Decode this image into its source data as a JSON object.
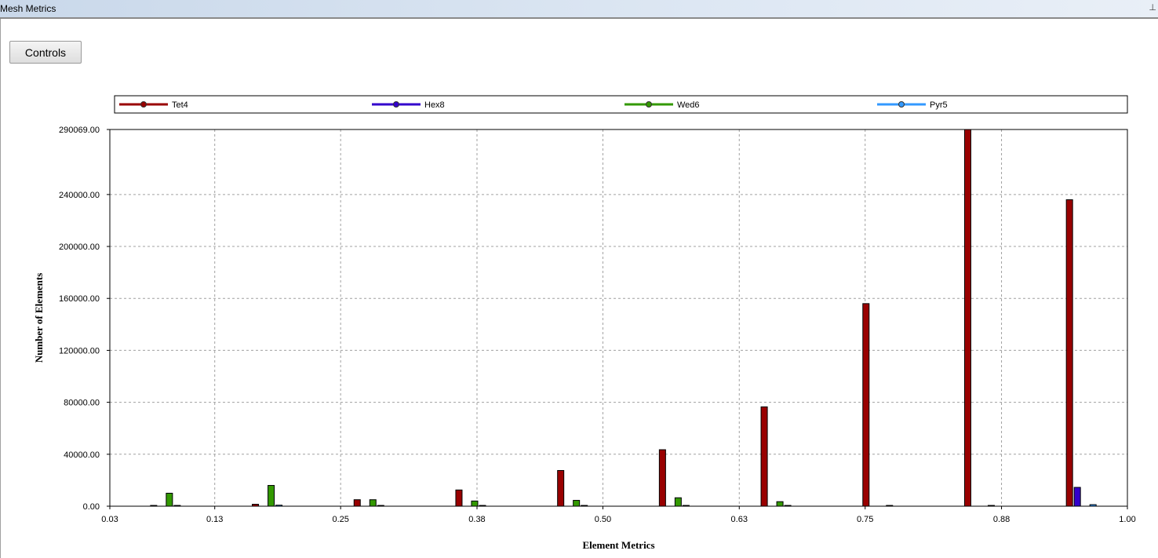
{
  "window": {
    "title": "Mesh Metrics"
  },
  "toolbar": {
    "controls_label": "Controls"
  },
  "chart_data": {
    "type": "bar",
    "xlabel": "Element Metrics",
    "ylabel": "Number of Elements",
    "x_ticks": [
      "0.03",
      "0.13",
      "0.25",
      "0.38",
      "0.50",
      "0.63",
      "0.75",
      "0.88",
      "1.00"
    ],
    "y_ticks": [
      "0.00",
      "40000.00",
      "80000.00",
      "120000.00",
      "160000.00",
      "200000.00",
      "240000.00",
      "290069.00"
    ],
    "xlim": [
      0.03,
      1.0
    ],
    "ylim": [
      0,
      290069
    ],
    "grid": true,
    "legend_position": "top",
    "bins": [
      0.083,
      0.18,
      0.277,
      0.374,
      0.471,
      0.568,
      0.665,
      0.762,
      0.859,
      0.956
    ],
    "series": [
      {
        "name": "Tet4",
        "color": "#990000",
        "values": [
          200,
          1500,
          5000,
          12500,
          27500,
          43500,
          76500,
          156000,
          290069,
          236000
        ]
      },
      {
        "name": "Hex8",
        "color": "#3300cc",
        "values": [
          0,
          0,
          0,
          0,
          0,
          0,
          0,
          0,
          0,
          14500
        ]
      },
      {
        "name": "Wed6",
        "color": "#339900",
        "values": [
          10000,
          16000,
          5000,
          4000,
          4500,
          6500,
          3500,
          0,
          0,
          0
        ]
      },
      {
        "name": "Pyr5",
        "color": "#3399ff",
        "values": [
          300,
          800,
          500,
          300,
          300,
          500,
          400,
          200,
          300,
          1200
        ]
      }
    ]
  }
}
